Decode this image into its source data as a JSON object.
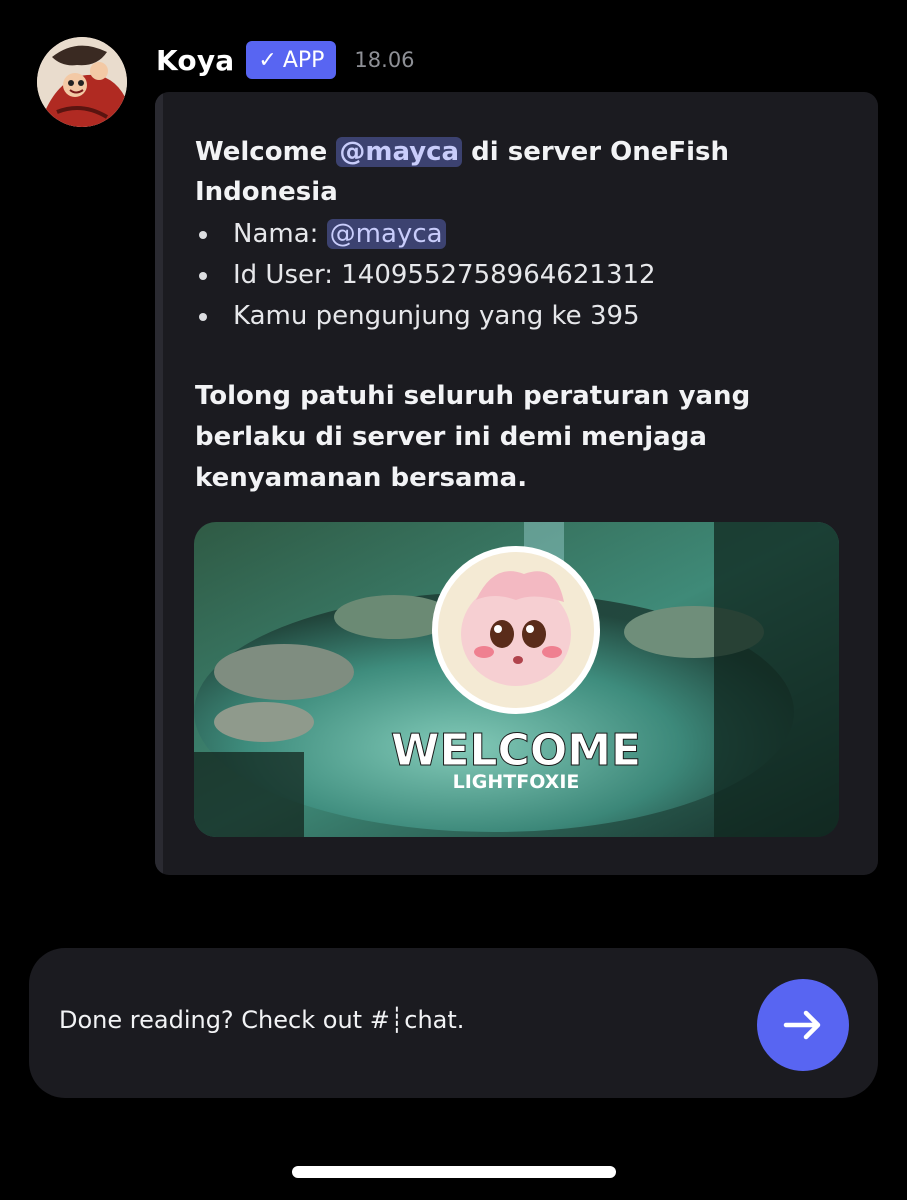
{
  "message": {
    "author": "Koya",
    "badge_label": "APP",
    "timestamp": "18.06",
    "avatar_icon": "anime-character-avatar"
  },
  "embed": {
    "title_prefix": "Welcome ",
    "title_mention": "@mayca",
    "title_suffix": " di server OneFish Indonesia",
    "bullets": {
      "name_label": "Nama: ",
      "name_mention": "@mayca",
      "user_id": "Id User: 1409552758964621312",
      "visitor": "Kamu pengunjung yang ke 395"
    },
    "rules_text": "Tolong patuhi seluruh peraturan yang berlaku di server ini demi menjaga kenyamanan bersama.",
    "image": {
      "welcome_text": "WELCOME",
      "username_text": "LIGHTFOXIE",
      "character_icon": "pink-fairy-pokemon-avatar"
    }
  },
  "composer": {
    "prompt_text": "Done reading? Check out #┊chat.",
    "send_icon": "arrow-right-icon"
  },
  "colors": {
    "accent": "#5865f2",
    "background": "#000000",
    "card": "#1b1b20",
    "mention_bg": "#3c4270",
    "mention_text": "#c9cdfb"
  }
}
